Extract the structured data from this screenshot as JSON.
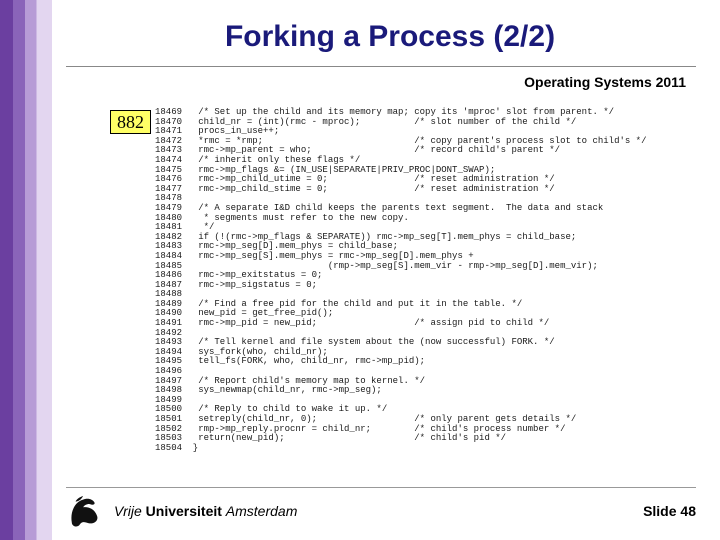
{
  "slide": {
    "title": "Forking a Process (2/2)",
    "subheader": "Operating Systems 2011",
    "page_badge": "882",
    "footer": {
      "university_part1": "Vrije ",
      "university_part2": "Universiteit ",
      "university_part3": "Amsterdam",
      "pagenum_label": "Slide ",
      "pagenum": "48"
    }
  },
  "code_lines": [
    {
      "ln": "18469",
      "txt": "  /* Set up the child and its memory map; copy its 'mproc' slot from parent. */"
    },
    {
      "ln": "18470",
      "txt": "  child_nr = (int)(rmc - mproc);          /* slot number of the child */"
    },
    {
      "ln": "18471",
      "txt": "  procs_in_use++;"
    },
    {
      "ln": "18472",
      "txt": "  *rmc = *rmp;                            /* copy parent's process slot to child's */"
    },
    {
      "ln": "18473",
      "txt": "  rmc->mp_parent = who;                   /* record child's parent */"
    },
    {
      "ln": "18474",
      "txt": "  /* inherit only these flags */"
    },
    {
      "ln": "18475",
      "txt": "  rmc->mp_flags &= (IN_USE|SEPARATE|PRIV_PROC|DONT_SWAP);"
    },
    {
      "ln": "18476",
      "txt": "  rmc->mp_child_utime = 0;                /* reset administration */"
    },
    {
      "ln": "18477",
      "txt": "  rmc->mp_child_stime = 0;                /* reset administration */"
    },
    {
      "ln": "18478",
      "txt": ""
    },
    {
      "ln": "18479",
      "txt": "  /* A separate I&D child keeps the parents text segment.  The data and stack"
    },
    {
      "ln": "18480",
      "txt": "   * segments must refer to the new copy."
    },
    {
      "ln": "18481",
      "txt": "   */"
    },
    {
      "ln": "18482",
      "txt": "  if (!(rmc->mp_flags & SEPARATE)) rmc->mp_seg[T].mem_phys = child_base;"
    },
    {
      "ln": "18483",
      "txt": "  rmc->mp_seg[D].mem_phys = child_base;"
    },
    {
      "ln": "18484",
      "txt": "  rmc->mp_seg[S].mem_phys = rmc->mp_seg[D].mem_phys +"
    },
    {
      "ln": "18485",
      "txt": "                          (rmp->mp_seg[S].mem_vir - rmp->mp_seg[D].mem_vir);"
    },
    {
      "ln": "18486",
      "txt": "  rmc->mp_exitstatus = 0;"
    },
    {
      "ln": "18487",
      "txt": "  rmc->mp_sigstatus = 0;"
    },
    {
      "ln": "18488",
      "txt": ""
    },
    {
      "ln": "18489",
      "txt": "  /* Find a free pid for the child and put it in the table. */"
    },
    {
      "ln": "18490",
      "txt": "  new_pid = get_free_pid();"
    },
    {
      "ln": "18491",
      "txt": "  rmc->mp_pid = new_pid;                  /* assign pid to child */"
    },
    {
      "ln": "18492",
      "txt": ""
    },
    {
      "ln": "18493",
      "txt": "  /* Tell kernel and file system about the (now successful) FORK. */"
    },
    {
      "ln": "18494",
      "txt": "  sys_fork(who, child_nr);"
    },
    {
      "ln": "18495",
      "txt": "  tell_fs(FORK, who, child_nr, rmc->mp_pid);"
    },
    {
      "ln": "18496",
      "txt": ""
    },
    {
      "ln": "18497",
      "txt": "  /* Report child's memory map to kernel. */"
    },
    {
      "ln": "18498",
      "txt": "  sys_newmap(child_nr, rmc->mp_seg);"
    },
    {
      "ln": "18499",
      "txt": ""
    },
    {
      "ln": "18500",
      "txt": "  /* Reply to child to wake it up. */"
    },
    {
      "ln": "18501",
      "txt": "  setreply(child_nr, 0);                  /* only parent gets details */"
    },
    {
      "ln": "18502",
      "txt": "  rmp->mp_reply.procnr = child_nr;        /* child's process number */"
    },
    {
      "ln": "18503",
      "txt": "  return(new_pid);                        /* child's pid */"
    },
    {
      "ln": "18504",
      "txt": " }"
    }
  ]
}
